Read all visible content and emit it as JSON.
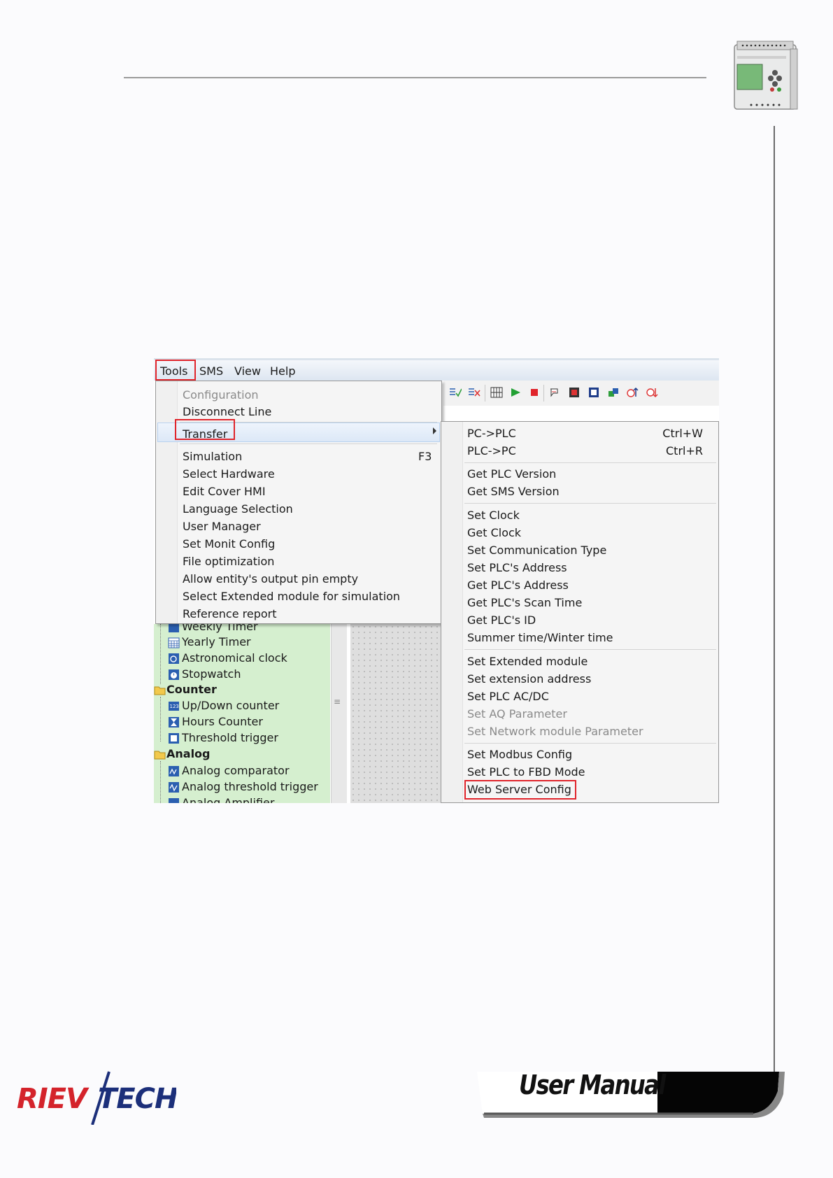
{
  "header": {},
  "screenshot": {
    "menubar": [
      "Tools",
      "SMS",
      "View",
      "Help"
    ],
    "tools_menu": {
      "items": [
        {
          "label": "Configuration",
          "disabled": true
        },
        {
          "label": "Disconnect Line"
        },
        {
          "label": "Transfer",
          "highlighted": true,
          "submenu": true
        },
        {
          "label": "Simulation",
          "shortcut": "F3"
        },
        {
          "label": "Select Hardware"
        },
        {
          "label": "Edit Cover HMI"
        },
        {
          "label": "Language Selection"
        },
        {
          "label": "User Manager"
        },
        {
          "label": "Set Monit Config"
        },
        {
          "label": "File optimization"
        },
        {
          "label": "Allow entity's output pin empty"
        },
        {
          "label": "Select Extended module for simulation"
        },
        {
          "label": "Reference report"
        }
      ]
    },
    "transfer_submenu": {
      "items": [
        {
          "label": "PC->PLC",
          "shortcut": "Ctrl+W"
        },
        {
          "label": "PLC->PC",
          "shortcut": "Ctrl+R"
        },
        {
          "label": "Get PLC Version"
        },
        {
          "label": "Get SMS Version"
        },
        {
          "label": "Set Clock"
        },
        {
          "label": "Get Clock"
        },
        {
          "label": "Set Communication Type"
        },
        {
          "label": "Set PLC's Address"
        },
        {
          "label": "Get PLC's Address"
        },
        {
          "label": "Get PLC's Scan Time"
        },
        {
          "label": "Get PLC's ID"
        },
        {
          "label": "Summer time/Winter time"
        },
        {
          "label": "Set Extended module"
        },
        {
          "label": "Set extension address"
        },
        {
          "label": "Set PLC AC/DC"
        },
        {
          "label": "Set AQ Parameter",
          "disabled": true
        },
        {
          "label": "Set Network module Parameter",
          "disabled": true
        },
        {
          "label": "Set Modbus Config"
        },
        {
          "label": "Set PLC to FBD Mode"
        },
        {
          "label": "Web Server Config",
          "highlighted_box": true
        }
      ]
    },
    "tree": {
      "items": [
        {
          "label": "Weekly Timer",
          "icon": "weekly-timer-icon"
        },
        {
          "label": "Yearly Timer",
          "icon": "calendar-icon"
        },
        {
          "label": "Astronomical clock",
          "icon": "astronomical-clock-icon"
        },
        {
          "label": "Stopwatch",
          "icon": "stopwatch-icon"
        },
        {
          "label": "Counter",
          "category": true,
          "icon": "folder-icon"
        },
        {
          "label": "Up/Down counter",
          "icon": "counter-icon"
        },
        {
          "label": "Hours Counter",
          "icon": "hourglass-icon"
        },
        {
          "label": "Threshold trigger",
          "icon": "threshold-icon"
        },
        {
          "label": "Analog",
          "category": true,
          "icon": "folder-icon"
        },
        {
          "label": "Analog comparator",
          "icon": "analog-comparator-icon"
        },
        {
          "label": "Analog threshold trigger",
          "icon": "analog-threshold-icon"
        },
        {
          "label": "Analog Amplifier",
          "icon": "analog-amplifier-icon"
        }
      ]
    }
  },
  "footer": {
    "logo_text": "RIEV/TECH",
    "badge_text": "User Manual"
  },
  "colors": {
    "highlight_box": "#e0242b",
    "tree_background": "#d5efcf",
    "logo_red": "#d4232b",
    "logo_navy": "#1c2f7a"
  }
}
